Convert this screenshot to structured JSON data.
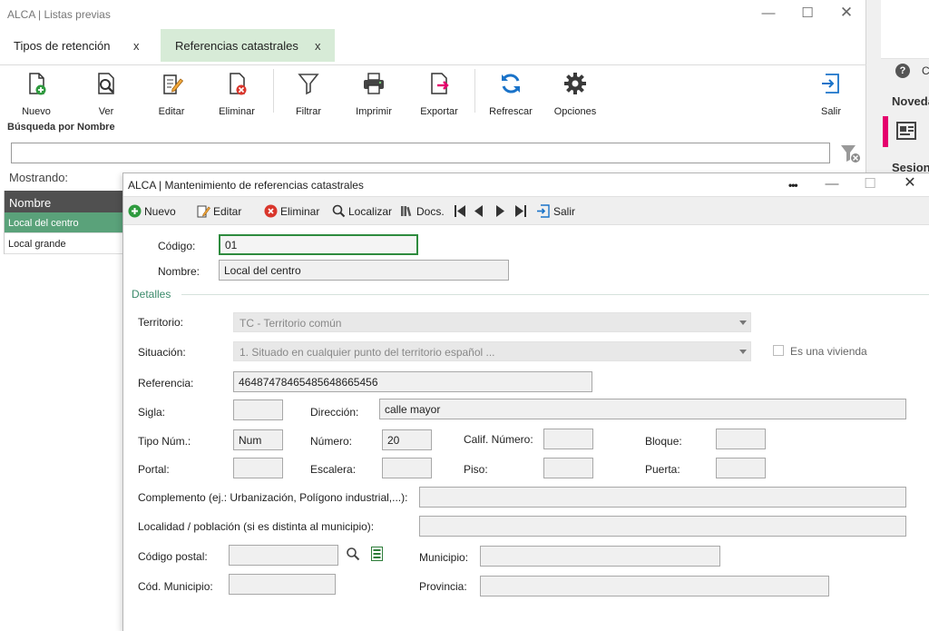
{
  "main_window": {
    "title": "ALCA | Listas previas",
    "controls": {
      "minimize": "—",
      "maximize": "☐",
      "close": "✕"
    }
  },
  "tabs": [
    {
      "label": "Tipos de retención",
      "close": "x",
      "active": false
    },
    {
      "label": "Referencias catastrales",
      "close": "x",
      "active": true
    }
  ],
  "toolbar": {
    "nuevo": "Nuevo",
    "ver": "Ver",
    "editar": "Editar",
    "eliminar": "Eliminar",
    "filtrar": "Filtrar",
    "imprimir": "Imprimir",
    "exportar": "Exportar",
    "refrescar": "Refrescar",
    "opciones": "Opciones",
    "salir": "Salir"
  },
  "search": {
    "label": "Búsqueda por Nombre",
    "value": ""
  },
  "list": {
    "showing_label": "Mostrando:",
    "header": "Nombre",
    "rows": [
      "Local del centro",
      "Local grande"
    ]
  },
  "right_panel": {
    "help_icon": "?",
    "help_text": "C",
    "novedades": "Noveda",
    "sesiones": "Sesione"
  },
  "dialog": {
    "title": "ALCA | Mantenimiento de referencias catastrales",
    "dots": "•••",
    "controls": {
      "minimize": "—",
      "maximize": "☐",
      "close": "✕"
    },
    "toolbar": {
      "nuevo": "Nuevo",
      "editar": "Editar",
      "eliminar": "Eliminar",
      "localizar": "Localizar",
      "docs": "Docs.",
      "salir": "Salir"
    },
    "form": {
      "codigo_label": "Código:",
      "codigo": "01",
      "nombre_label": "Nombre:",
      "nombre": "Local del centro",
      "detalles": "Detalles",
      "territorio_label": "Territorio:",
      "territorio": "TC - Territorio común",
      "situacion_label": "Situación:",
      "situacion": "1. Situado en cualquier punto del territorio español ...",
      "vivienda_label": "Es una vivienda",
      "referencia_label": "Referencia:",
      "referencia": "46487478465485648665456",
      "sigla_label": "Sigla:",
      "sigla": "",
      "direccion_label": "Dirección:",
      "direccion": "calle mayor",
      "tipo_num_label": "Tipo Núm.:",
      "tipo_num": "Num",
      "numero_label": "Número:",
      "numero": "20",
      "calif_label": "Calif. Número:",
      "calif": "",
      "bloque_label": "Bloque:",
      "bloque": "",
      "portal_label": "Portal:",
      "portal": "",
      "escalera_label": "Escalera:",
      "escalera": "",
      "piso_label": "Piso:",
      "piso": "",
      "puerta_label": "Puerta:",
      "puerta": "",
      "complemento_label": "Complemento (ej.: Urbanización, Polígono industrial,...):",
      "complemento": "",
      "localidad_label": "Localidad / población (si es distinta al municipio):",
      "localidad": "",
      "cp_label": "Código postal:",
      "cp": "",
      "municipio_label": "Municipio:",
      "municipio": "",
      "cod_municipio_label": "Cód. Municipio:",
      "cod_municipio": "",
      "provincia_label": "Provincia:",
      "provincia": ""
    }
  },
  "colors": {
    "active_tab": "#d7ebd7",
    "selected_row": "#5aa27a",
    "list_header": "#505050",
    "accent_green": "#3a8a6a",
    "news_accent": "#e5006d"
  }
}
